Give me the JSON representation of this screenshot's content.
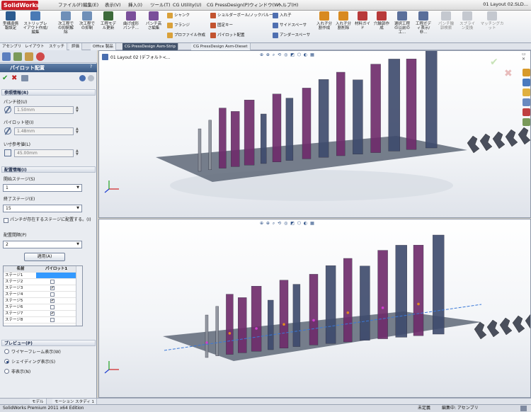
{
  "app": {
    "logo_text": "SolidWorks",
    "doc_title": "01 Layout 02.SLD...",
    "menu": [
      "ファイル(F)",
      "編集(E)",
      "表示(V)",
      "挿入(I)",
      "ツール(T)",
      "CG Utility(U)",
      "CG PressDesign(P)",
      "ウィンドウ(W)",
      "ヘルプ(H)"
    ]
  },
  "ribbon": {
    "big_buttons": [
      {
        "label": "型構造情報設定",
        "icon": "die-structure-icon"
      },
      {
        "label": "ストリップレイアウト作成/編集",
        "icon": "strip-layout-icon"
      },
      {
        "label": "次工程での抑制解除",
        "icon": "next-process-unsuppress-icon"
      },
      {
        "label": "次工程での抑制",
        "icon": "next-process-suppress-icon"
      },
      {
        "label": "工程モデル更新",
        "icon": "process-model-update-icon"
      },
      {
        "label": "曲げ成形パンチ...",
        "icon": "bend-punch-icon"
      },
      {
        "label": "パンチ高さ編集",
        "icon": "punch-height-icon"
      }
    ],
    "small_col1": [
      "シャンク",
      "フランジ",
      "プロファイル作成"
    ],
    "small_col2": [
      "ショルダーボール/ノックバルーフ",
      "固定キー",
      "パイロット配置"
    ],
    "small_col3": [
      "入れ子",
      "サイドスペーサ",
      "アンダースペーサ"
    ],
    "big_buttons2": [
      {
        "label": "入れ子分割作成",
        "icon": "insert-split-icon"
      },
      {
        "label": "入れ子分割削除",
        "icon": "insert-split-delete-icon"
      },
      {
        "label": "材料ガイド",
        "icon": "material-guide-icon"
      },
      {
        "label": "穴輪郭作成",
        "icon": "hole-contour-icon"
      },
      {
        "label": "選択工程の以前の工...",
        "icon": "previous-process-icon"
      },
      {
        "label": "工程ボディ表示/非...",
        "icon": "process-body-toggle-icon"
      },
      {
        "label": "パンチ輪郭検索",
        "icon": "punch-contour-search-icon"
      },
      {
        "label": "スプライン変換",
        "icon": "spline-convert-icon"
      },
      {
        "label": "マッチングカット",
        "icon": "matching-cut-icon"
      }
    ]
  },
  "tabs": [
    "アセンブリ",
    "レイアウト",
    "スケッチ",
    "評価",
    "Office 製品",
    "CG PressDesign Asm-Strip",
    "CG PressDesign Asm-Dieset"
  ],
  "active_tab": "CG PressDesign Asm-Strip",
  "panel": {
    "title": "パイロット配置",
    "help": "?",
    "section_ref": "参照情報(R)",
    "punch_dia_label": "パンチ径(U)",
    "punch_dia_value": "1.50mm",
    "pilot_dia_label": "パイロット径(I)",
    "pilot_dia_value": "1.48mm",
    "ref_length_label": "い寸参考値(L)",
    "ref_length_value": "45.00mm",
    "section_place": "配置情報(I)",
    "start_stage_label": "開始ステージ(S)",
    "start_stage_value": "1",
    "end_stage_label": "終了ステージ(E)",
    "end_stage_value": "15",
    "exist_punch_label": "パンチが存在するステージに配置する。(I)",
    "interval_label": "配置間隔(P)",
    "interval_value": "2",
    "apply_button": "適用(A)",
    "table_headers": [
      "名前",
      "パイロット1"
    ],
    "table_rows": [
      {
        "name": "ステージ1",
        "checked": false,
        "selected": true
      },
      {
        "name": "ステージ2",
        "checked": false,
        "selected": false
      },
      {
        "name": "ステージ3",
        "checked": true,
        "selected": false
      },
      {
        "name": "ステージ4",
        "checked": false,
        "selected": false
      },
      {
        "name": "ステージ5",
        "checked": true,
        "selected": false
      },
      {
        "name": "ステージ6",
        "checked": false,
        "selected": false
      },
      {
        "name": "ステージ7",
        "checked": true,
        "selected": false
      },
      {
        "name": "ステージ8",
        "checked": false,
        "selected": false
      }
    ],
    "section_preview": "プレビュー(P)",
    "preview_options": [
      {
        "label": "ワイヤーフレーム表示(W)",
        "on": false
      },
      {
        "label": "シェイディング表示(S)",
        "on": true
      },
      {
        "label": "非表示(N)",
        "on": false
      }
    ]
  },
  "viewport": {
    "tree_item": "01 Layout 02 (デフォルト<...",
    "view_tools": "⊕ ⊕ ⌕ ⟲ ◎ ◩ ⬡ ◐ ▦",
    "colors": {
      "purple": "#6e2a6a",
      "steel": "#3d4a6c",
      "plate": "#5f6878",
      "grey": "#8a8f99"
    }
  },
  "bottom_tabs": [
    "モデル",
    "モーション スタディ 1"
  ],
  "status": {
    "product": "SolidWorks Premium 2011 x64 Edition",
    "state": "未定義",
    "mode": "編集中: アセンブリ"
  }
}
